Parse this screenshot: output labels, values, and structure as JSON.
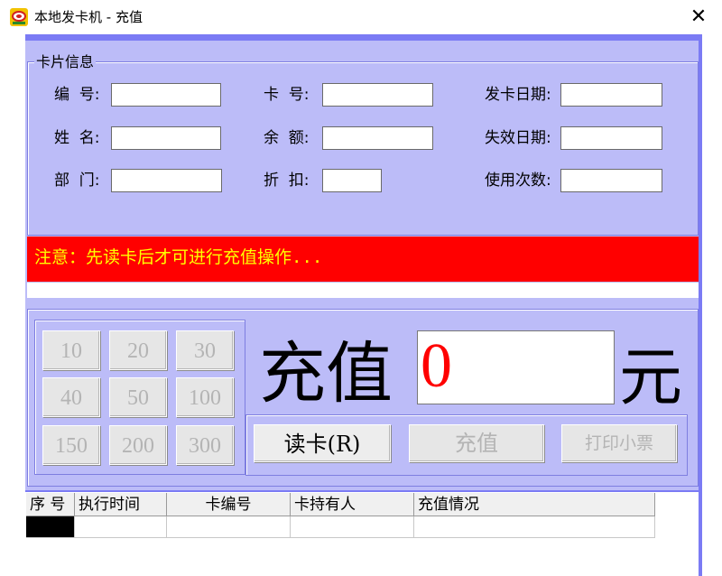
{
  "window": {
    "title": "本地发卡机 - 充值",
    "close_glyph": "✕",
    "icon": "app-logo-icon"
  },
  "card_info": {
    "legend": "卡片信息",
    "fields": [
      {
        "label": "编  号:",
        "value": ""
      },
      {
        "label": "卡  号:",
        "value": ""
      },
      {
        "label": "发卡日期:",
        "value": ""
      },
      {
        "label": "姓  名:",
        "value": ""
      },
      {
        "label": "余  额:",
        "value": ""
      },
      {
        "label": "失效日期:",
        "value": ""
      },
      {
        "label": "部  门:",
        "value": ""
      },
      {
        "label": "折  扣:",
        "value": ""
      },
      {
        "label": "使用次数:",
        "value": ""
      }
    ]
  },
  "notice": "注意：先读卡后才可进行充值操作...",
  "amount_buttons": [
    "10",
    "20",
    "30",
    "40",
    "50",
    "100",
    "150",
    "200",
    "300"
  ],
  "recharge": {
    "label": "充值 :",
    "amount": "0",
    "unit": "元"
  },
  "actions": {
    "read_card": "读卡(R)",
    "recharge": "充值",
    "print_receipt": "打印小票"
  },
  "table": {
    "columns": [
      "序 号",
      "执行时间",
      "卡编号",
      "卡持有人",
      "充值情况"
    ]
  },
  "colors": {
    "frame": "#7b7bf4",
    "panel": "#bcbcf8",
    "notice_bg": "#ff0000",
    "notice_text": "#ffff00",
    "amount_text": "#ff0000"
  }
}
